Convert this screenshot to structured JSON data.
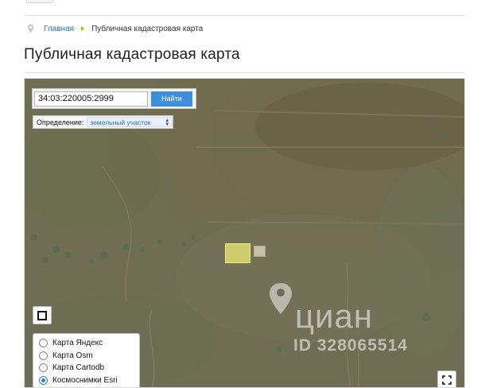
{
  "breadcrumb": {
    "home_label": "Главная",
    "current_label": "Публичная кадастровая карта"
  },
  "page_title": "Публичная кадастровая карта",
  "search": {
    "value": "34:03:220005:2999",
    "button_label": "Найти"
  },
  "definition": {
    "label": "Определение:",
    "selected": "земельный участок"
  },
  "layers": [
    {
      "label": "Карта Яндекс",
      "selected": false
    },
    {
      "label": "Карта Osm",
      "selected": false
    },
    {
      "label": "Карта Cartodb",
      "selected": false
    },
    {
      "label": "Космоснимки Esri",
      "selected": true
    }
  ],
  "watermark": {
    "brand": "циан",
    "id_text": "ID 328065514"
  },
  "colors": {
    "link": "#2a6fb8",
    "button": "#3d8edb",
    "parcel_fill": "#ecebb0",
    "breadcrumb_separator": "#e0a000"
  },
  "icons": {
    "breadcrumb": "map-pin-icon",
    "map_control_left": "fullscreen-icon",
    "map_control_right": "fullscreen-icon",
    "watermark": "location-pin-icon"
  }
}
